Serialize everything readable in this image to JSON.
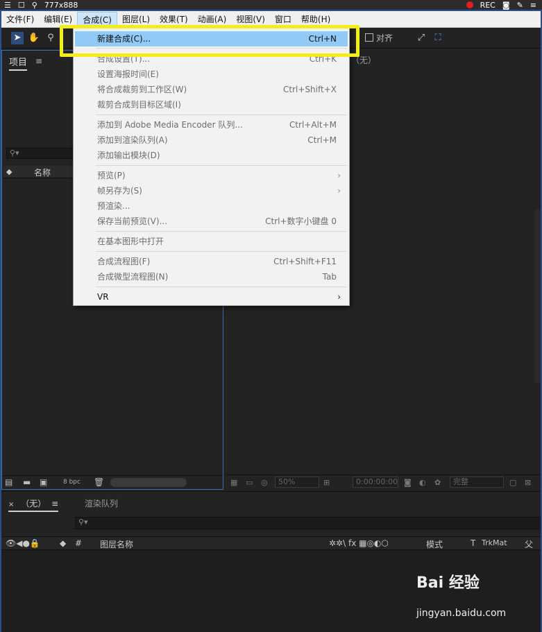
{
  "capture_bar": {
    "size_label": "777x888",
    "rec_label": "REC"
  },
  "menubar": {
    "items": [
      "文件(F)",
      "编辑(E)",
      "合成(C)",
      "图层(L)",
      "效果(T)",
      "动画(A)",
      "视图(V)",
      "窗口",
      "帮助(H)"
    ]
  },
  "toolbar": {
    "align_label": "对齐"
  },
  "project_panel": {
    "tab_label": "项目",
    "column_name": "名称",
    "bpc_label": "8 bpc"
  },
  "comp_panel": {
    "tab_text": "（无）",
    "zoom": "50%",
    "timecode": "0:00:00:00",
    "resolution": "完整"
  },
  "timeline": {
    "tab_none": "（无）",
    "tab_render": "渲染队列",
    "col_hash": "#",
    "col_layer_name": "图层名称",
    "col_mode": "模式",
    "col_t": "T",
    "col_trkmat": "TrkMat",
    "col_parent": "父级"
  },
  "dropdown": {
    "items": [
      {
        "label": "新建合成(C)...",
        "shortcut": "Ctrl+N",
        "highlight": true,
        "disabled": false
      },
      {
        "label": "合成设置(T)...",
        "shortcut": "Ctrl+K",
        "highlight": false,
        "disabled": true
      },
      {
        "label": "设置海报时间(E)",
        "shortcut": "",
        "highlight": false,
        "disabled": true
      },
      {
        "label": "将合成裁剪到工作区(W)",
        "shortcut": "Ctrl+Shift+X",
        "highlight": false,
        "disabled": true
      },
      {
        "label": "裁剪合成到目标区域(I)",
        "shortcut": "",
        "highlight": false,
        "disabled": true
      },
      {
        "label": "添加到 Adobe Media Encoder 队列...",
        "shortcut": "Ctrl+Alt+M",
        "highlight": false,
        "disabled": true
      },
      {
        "label": "添加到渲染队列(A)",
        "shortcut": "Ctrl+M",
        "highlight": false,
        "disabled": true
      },
      {
        "label": "添加输出模块(D)",
        "shortcut": "",
        "highlight": false,
        "disabled": true
      },
      {
        "label": "预览(P)",
        "shortcut": "",
        "highlight": false,
        "disabled": true
      },
      {
        "label": "帧另存为(S)",
        "shortcut": "",
        "highlight": false,
        "disabled": true
      },
      {
        "label": "预渲染...",
        "shortcut": "",
        "highlight": false,
        "disabled": true
      },
      {
        "label": "保存当前预览(V)...",
        "shortcut": "Ctrl+数字小键盘 0",
        "highlight": false,
        "disabled": true
      },
      {
        "label": "在基本图形中打开",
        "shortcut": "",
        "highlight": false,
        "disabled": true
      },
      {
        "label": "合成流程图(F)",
        "shortcut": "Ctrl+Shift+F11",
        "highlight": false,
        "disabled": true
      },
      {
        "label": "合成微型流程图(N)",
        "shortcut": "Tab",
        "highlight": false,
        "disabled": true
      },
      {
        "label": "VR",
        "shortcut": "",
        "highlight": false,
        "disabled": false
      }
    ]
  },
  "watermark": {
    "brand": "Bai 经验",
    "url": "jingyan.baidu.com"
  },
  "colors": {
    "highlight": "#f3ee1a",
    "menu_hover": "#91c9f7",
    "frame": "#2a4f8a"
  }
}
